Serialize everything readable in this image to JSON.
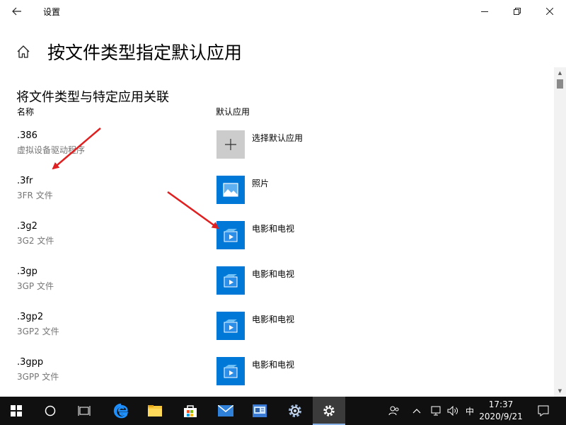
{
  "window": {
    "title": "设置",
    "back_icon": "back-arrow-icon",
    "controls": [
      "minimize-icon",
      "restore-icon",
      "close-icon"
    ]
  },
  "page": {
    "home_icon": "home-icon",
    "title": "按文件类型指定默认应用",
    "section_title": "将文件类型与特定应用关联",
    "col_name": "名称",
    "col_default_app": "默认应用"
  },
  "rows": [
    {
      "ext": ".386",
      "desc": "虚拟设备驱动程序",
      "app": "选择默认应用",
      "icon": "plus-icon",
      "tile_color": "#cccccc"
    },
    {
      "ext": ".3fr",
      "desc": "3FR 文件",
      "app": "照片",
      "icon": "photos-icon",
      "tile_color": "#0078d7"
    },
    {
      "ext": ".3g2",
      "desc": "3G2 文件",
      "app": "电影和电视",
      "icon": "movies-tv-icon",
      "tile_color": "#0078d7"
    },
    {
      "ext": ".3gp",
      "desc": "3GP 文件",
      "app": "电影和电视",
      "icon": "movies-tv-icon",
      "tile_color": "#0078d7"
    },
    {
      "ext": ".3gp2",
      "desc": "3GP2 文件",
      "app": "电影和电视",
      "icon": "movies-tv-icon",
      "tile_color": "#0078d7"
    },
    {
      "ext": ".3gpp",
      "desc": "3GPP 文件",
      "app": "电影和电视",
      "icon": "movies-tv-icon",
      "tile_color": "#0078d7"
    }
  ],
  "annotation_color": "#e02020",
  "taskbar": {
    "items": [
      "start-icon",
      "search-circle-icon",
      "task-view-icon",
      "edge-icon",
      "file-explorer-icon",
      "store-icon",
      "mail-icon",
      "app-icon",
      "settings-gear-icon",
      "settings-active-icon"
    ],
    "tray": {
      "people_icon": "people-icon",
      "chevron_icon": "chevron-up-icon",
      "network_icon": "network-icon",
      "volume_icon": "volume-icon",
      "ime": "中",
      "time": "17:37",
      "date": "2020/9/21",
      "notification_icon": "notification-icon"
    }
  }
}
